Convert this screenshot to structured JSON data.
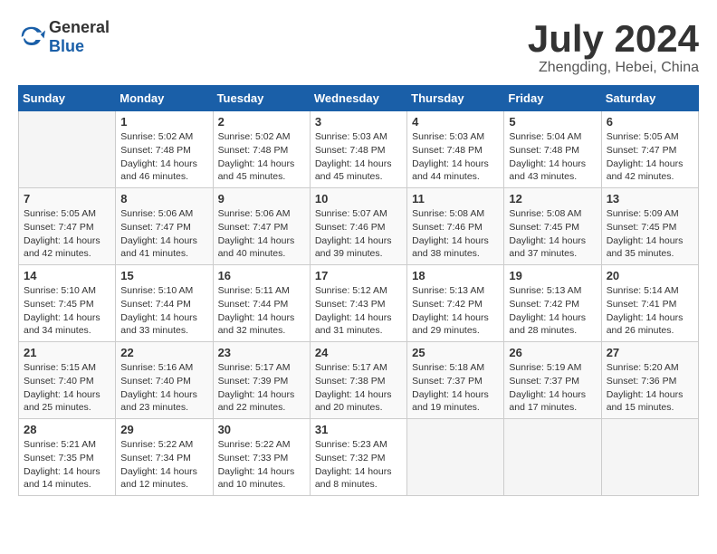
{
  "header": {
    "logo_general": "General",
    "logo_blue": "Blue",
    "month_year": "July 2024",
    "location": "Zhengding, Hebei, China"
  },
  "days_of_week": [
    "Sunday",
    "Monday",
    "Tuesday",
    "Wednesday",
    "Thursday",
    "Friday",
    "Saturday"
  ],
  "weeks": [
    [
      {
        "num": "",
        "empty": true
      },
      {
        "num": "1",
        "sunrise": "Sunrise: 5:02 AM",
        "sunset": "Sunset: 7:48 PM",
        "daylight": "Daylight: 14 hours",
        "minutes": "and 46 minutes."
      },
      {
        "num": "2",
        "sunrise": "Sunrise: 5:02 AM",
        "sunset": "Sunset: 7:48 PM",
        "daylight": "Daylight: 14 hours",
        "minutes": "and 45 minutes."
      },
      {
        "num": "3",
        "sunrise": "Sunrise: 5:03 AM",
        "sunset": "Sunset: 7:48 PM",
        "daylight": "Daylight: 14 hours",
        "minutes": "and 45 minutes."
      },
      {
        "num": "4",
        "sunrise": "Sunrise: 5:03 AM",
        "sunset": "Sunset: 7:48 PM",
        "daylight": "Daylight: 14 hours",
        "minutes": "and 44 minutes."
      },
      {
        "num": "5",
        "sunrise": "Sunrise: 5:04 AM",
        "sunset": "Sunset: 7:48 PM",
        "daylight": "Daylight: 14 hours",
        "minutes": "and 43 minutes."
      },
      {
        "num": "6",
        "sunrise": "Sunrise: 5:05 AM",
        "sunset": "Sunset: 7:47 PM",
        "daylight": "Daylight: 14 hours",
        "minutes": "and 42 minutes."
      }
    ],
    [
      {
        "num": "7",
        "sunrise": "Sunrise: 5:05 AM",
        "sunset": "Sunset: 7:47 PM",
        "daylight": "Daylight: 14 hours",
        "minutes": "and 42 minutes."
      },
      {
        "num": "8",
        "sunrise": "Sunrise: 5:06 AM",
        "sunset": "Sunset: 7:47 PM",
        "daylight": "Daylight: 14 hours",
        "minutes": "and 41 minutes."
      },
      {
        "num": "9",
        "sunrise": "Sunrise: 5:06 AM",
        "sunset": "Sunset: 7:47 PM",
        "daylight": "Daylight: 14 hours",
        "minutes": "and 40 minutes."
      },
      {
        "num": "10",
        "sunrise": "Sunrise: 5:07 AM",
        "sunset": "Sunset: 7:46 PM",
        "daylight": "Daylight: 14 hours",
        "minutes": "and 39 minutes."
      },
      {
        "num": "11",
        "sunrise": "Sunrise: 5:08 AM",
        "sunset": "Sunset: 7:46 PM",
        "daylight": "Daylight: 14 hours",
        "minutes": "and 38 minutes."
      },
      {
        "num": "12",
        "sunrise": "Sunrise: 5:08 AM",
        "sunset": "Sunset: 7:45 PM",
        "daylight": "Daylight: 14 hours",
        "minutes": "and 37 minutes."
      },
      {
        "num": "13",
        "sunrise": "Sunrise: 5:09 AM",
        "sunset": "Sunset: 7:45 PM",
        "daylight": "Daylight: 14 hours",
        "minutes": "and 35 minutes."
      }
    ],
    [
      {
        "num": "14",
        "sunrise": "Sunrise: 5:10 AM",
        "sunset": "Sunset: 7:45 PM",
        "daylight": "Daylight: 14 hours",
        "minutes": "and 34 minutes."
      },
      {
        "num": "15",
        "sunrise": "Sunrise: 5:10 AM",
        "sunset": "Sunset: 7:44 PM",
        "daylight": "Daylight: 14 hours",
        "minutes": "and 33 minutes."
      },
      {
        "num": "16",
        "sunrise": "Sunrise: 5:11 AM",
        "sunset": "Sunset: 7:44 PM",
        "daylight": "Daylight: 14 hours",
        "minutes": "and 32 minutes."
      },
      {
        "num": "17",
        "sunrise": "Sunrise: 5:12 AM",
        "sunset": "Sunset: 7:43 PM",
        "daylight": "Daylight: 14 hours",
        "minutes": "and 31 minutes."
      },
      {
        "num": "18",
        "sunrise": "Sunrise: 5:13 AM",
        "sunset": "Sunset: 7:42 PM",
        "daylight": "Daylight: 14 hours",
        "minutes": "and 29 minutes."
      },
      {
        "num": "19",
        "sunrise": "Sunrise: 5:13 AM",
        "sunset": "Sunset: 7:42 PM",
        "daylight": "Daylight: 14 hours",
        "minutes": "and 28 minutes."
      },
      {
        "num": "20",
        "sunrise": "Sunrise: 5:14 AM",
        "sunset": "Sunset: 7:41 PM",
        "daylight": "Daylight: 14 hours",
        "minutes": "and 26 minutes."
      }
    ],
    [
      {
        "num": "21",
        "sunrise": "Sunrise: 5:15 AM",
        "sunset": "Sunset: 7:40 PM",
        "daylight": "Daylight: 14 hours",
        "minutes": "and 25 minutes."
      },
      {
        "num": "22",
        "sunrise": "Sunrise: 5:16 AM",
        "sunset": "Sunset: 7:40 PM",
        "daylight": "Daylight: 14 hours",
        "minutes": "and 23 minutes."
      },
      {
        "num": "23",
        "sunrise": "Sunrise: 5:17 AM",
        "sunset": "Sunset: 7:39 PM",
        "daylight": "Daylight: 14 hours",
        "minutes": "and 22 minutes."
      },
      {
        "num": "24",
        "sunrise": "Sunrise: 5:17 AM",
        "sunset": "Sunset: 7:38 PM",
        "daylight": "Daylight: 14 hours",
        "minutes": "and 20 minutes."
      },
      {
        "num": "25",
        "sunrise": "Sunrise: 5:18 AM",
        "sunset": "Sunset: 7:37 PM",
        "daylight": "Daylight: 14 hours",
        "minutes": "and 19 minutes."
      },
      {
        "num": "26",
        "sunrise": "Sunrise: 5:19 AM",
        "sunset": "Sunset: 7:37 PM",
        "daylight": "Daylight: 14 hours",
        "minutes": "and 17 minutes."
      },
      {
        "num": "27",
        "sunrise": "Sunrise: 5:20 AM",
        "sunset": "Sunset: 7:36 PM",
        "daylight": "Daylight: 14 hours",
        "minutes": "and 15 minutes."
      }
    ],
    [
      {
        "num": "28",
        "sunrise": "Sunrise: 5:21 AM",
        "sunset": "Sunset: 7:35 PM",
        "daylight": "Daylight: 14 hours",
        "minutes": "and 14 minutes."
      },
      {
        "num": "29",
        "sunrise": "Sunrise: 5:22 AM",
        "sunset": "Sunset: 7:34 PM",
        "daylight": "Daylight: 14 hours",
        "minutes": "and 12 minutes."
      },
      {
        "num": "30",
        "sunrise": "Sunrise: 5:22 AM",
        "sunset": "Sunset: 7:33 PM",
        "daylight": "Daylight: 14 hours",
        "minutes": "and 10 minutes."
      },
      {
        "num": "31",
        "sunrise": "Sunrise: 5:23 AM",
        "sunset": "Sunset: 7:32 PM",
        "daylight": "Daylight: 14 hours",
        "minutes": "and 8 minutes."
      },
      {
        "num": "",
        "empty": true
      },
      {
        "num": "",
        "empty": true
      },
      {
        "num": "",
        "empty": true
      }
    ]
  ]
}
